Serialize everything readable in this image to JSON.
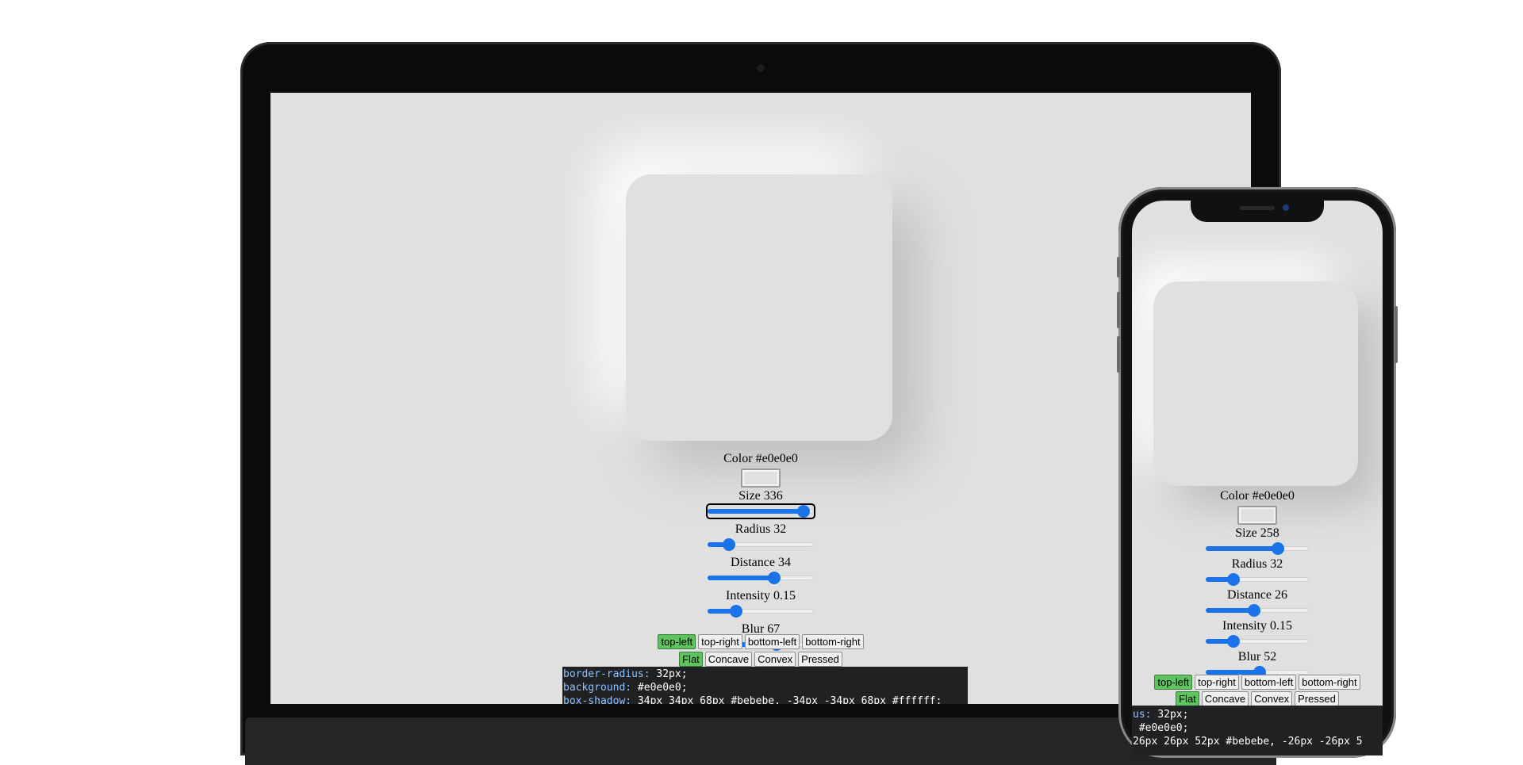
{
  "desktop": {
    "color_label": "Color #e0e0e0",
    "size_label": "Size 336",
    "radius_label": "Radius 32",
    "distance_label": "Distance 34",
    "intensity_label": "Intensity 0.15",
    "blur_label": "Blur 67",
    "sliders": {
      "size": 0.9,
      "radius": 0.2,
      "distance": 0.63,
      "intensity": 0.27,
      "blur": 0.65
    },
    "direction_buttons": [
      "top-left",
      "top-right",
      "bottom-left",
      "bottom-right"
    ],
    "active_direction": "top-left",
    "shape_buttons": [
      "Flat",
      "Concave",
      "Convex",
      "Pressed"
    ],
    "active_shape": "Flat",
    "code": {
      "radius_prop": "border-radius:",
      "radius_val": " 32px;",
      "bg_prop": "background:",
      "bg_val": " #e0e0e0;",
      "shadow_prop": "box-shadow:",
      "shadow_val": " 34px 34px 68px #bebebe, -34px -34px 68px #ffffff;"
    }
  },
  "mobile": {
    "color_label": "Color #e0e0e0",
    "size_label": "Size 258",
    "radius_label": "Radius 32",
    "distance_label": "Distance 26",
    "intensity_label": "Intensity 0.15",
    "blur_label": "Blur 52",
    "sliders": {
      "size": 0.7,
      "radius": 0.27,
      "distance": 0.47,
      "intensity": 0.27,
      "blur": 0.52
    },
    "direction_buttons": [
      "top-left",
      "top-right",
      "bottom-left",
      "bottom-right"
    ],
    "active_direction": "top-left",
    "shape_buttons": [
      "Flat",
      "Concave",
      "Convex",
      "Pressed"
    ],
    "active_shape": "Flat",
    "code": {
      "radius_prop": "us:",
      "radius_val": " 32px;",
      "bg_prop": "",
      "bg_val": " #e0e0e0;",
      "shadow_prop": "",
      "shadow_val": "26px 26px 52px #bebebe, -26px -26px 5"
    }
  },
  "colors": {
    "base": "#e0e0e0",
    "shadow_dark": "#bebebe",
    "shadow_light": "#ffffff",
    "accent": "#1a73e8",
    "active_button": "#5fc45f",
    "code_bg": "#1f2123",
    "code_prop": "#8fc3ff"
  }
}
